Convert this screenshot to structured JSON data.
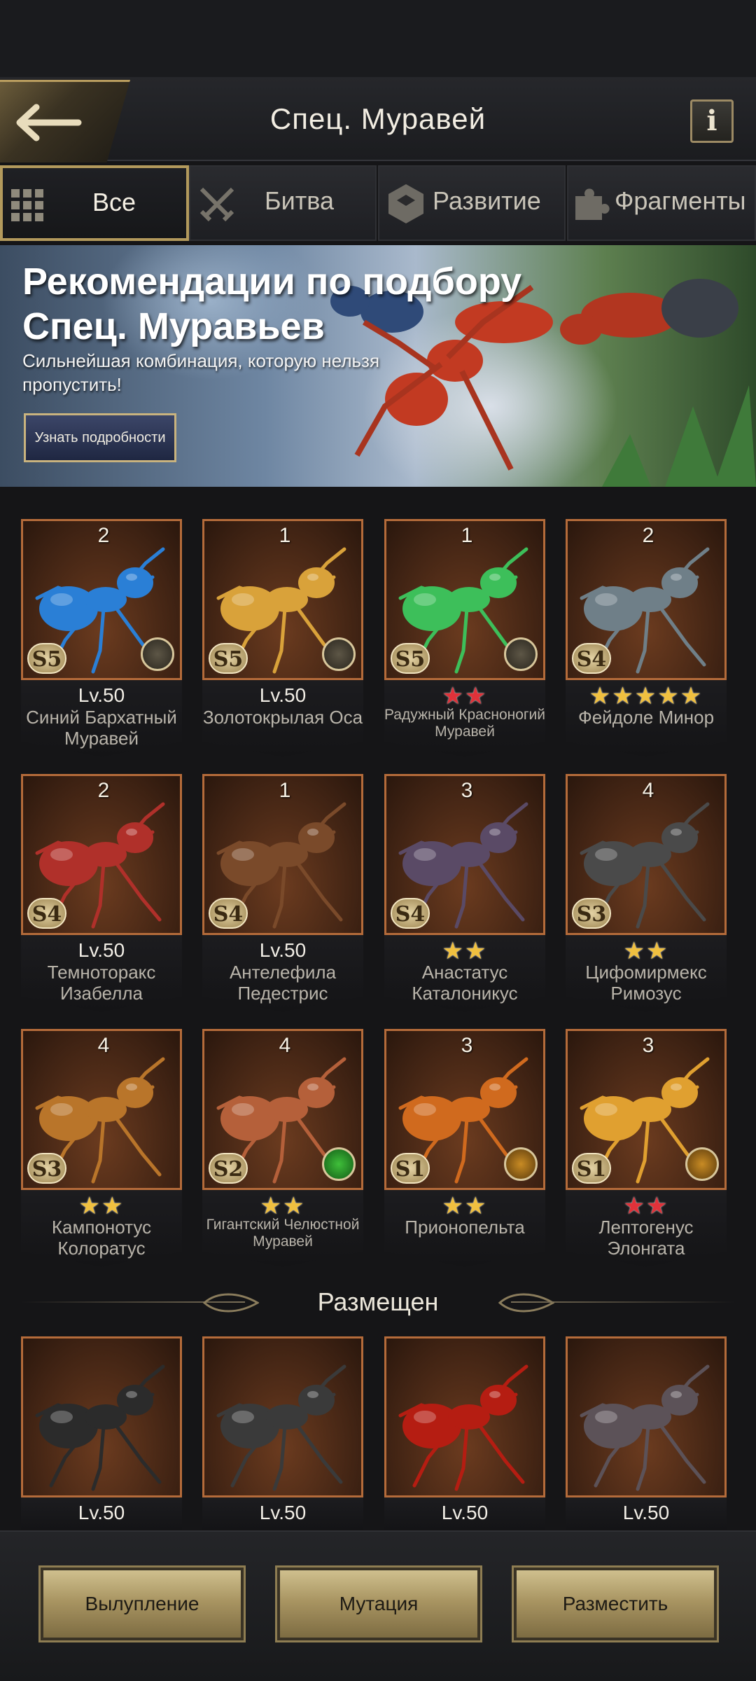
{
  "header": {
    "title": "Спец. Муравей",
    "info_label": "i"
  },
  "tabs": [
    {
      "label": "Все",
      "icon": "grid-icon",
      "active": true
    },
    {
      "label": "Битва",
      "icon": "crossed-swords-icon",
      "active": false
    },
    {
      "label": "Развитие",
      "icon": "hexagon-icon",
      "active": false
    },
    {
      "label": "Фрагменты",
      "icon": "puzzle-icon",
      "active": false
    }
  ],
  "banner": {
    "title": "Рекомендации по подбору Спец. Муравьев",
    "subtitle": "Сильнейшая комбинация, которую нельзя пропустить!",
    "button_label": "Узнать подробности"
  },
  "ants": [
    {
      "count": "2",
      "grade": "S5",
      "badge": "medal-icon",
      "level": "Lv.50",
      "stars": 0,
      "name": "Синий Бархатный Муравей",
      "color": "#2a7fd6"
    },
    {
      "count": "1",
      "grade": "S5",
      "badge": "medal-icon",
      "level": "Lv.50",
      "stars": 0,
      "name": "Золотокрылая Оса",
      "color": "#d9a23a"
    },
    {
      "count": "1",
      "grade": "S5",
      "badge": "medal-icon",
      "level": "",
      "stars": 2,
      "star_color": "red",
      "name": "Радужный Красноногий Муравей",
      "color": "#3dbf5a"
    },
    {
      "count": "2",
      "grade": "S4",
      "badge": "",
      "level": "",
      "stars": 5,
      "star_color": "gold",
      "name": "Фейдоле Минор",
      "color": "#6f7f88"
    },
    {
      "count": "2",
      "grade": "S4",
      "badge": "",
      "level": "Lv.50",
      "stars": 0,
      "name": "Темноторакс Изабелла",
      "color": "#b0302a"
    },
    {
      "count": "1",
      "grade": "S4",
      "badge": "",
      "level": "Lv.50",
      "stars": 0,
      "name": "Антелефила Педестрис",
      "color": "#7a4a2a"
    },
    {
      "count": "3",
      "grade": "S4",
      "badge": "",
      "level": "",
      "stars": 2,
      "star_color": "gold",
      "name": "Анастатус Каталоникус",
      "color": "#5a4a66"
    },
    {
      "count": "4",
      "grade": "S3",
      "badge": "",
      "level": "",
      "stars": 2,
      "star_color": "gold",
      "name": "Цифомирмекс Римозус",
      "color": "#4a4a4a"
    },
    {
      "count": "4",
      "grade": "S3",
      "badge": "",
      "level": "",
      "stars": 2,
      "star_color": "gold",
      "name": "Кампонотус Колоратус",
      "color": "#b9752a"
    },
    {
      "count": "4",
      "grade": "S2",
      "badge": "green",
      "level": "",
      "stars": 2,
      "star_color": "gold",
      "name": "Гигантский Челюстной Муравей",
      "color": "#b5603a"
    },
    {
      "count": "3",
      "grade": "S1",
      "badge": "amber",
      "level": "",
      "stars": 2,
      "star_color": "gold",
      "name": "Прионопельта",
      "color": "#d06a1e"
    },
    {
      "count": "3",
      "grade": "S1",
      "badge": "amber",
      "level": "",
      "stars": 2,
      "star_color": "red",
      "name": "Лептогенус Элонгата",
      "color": "#e0a030"
    }
  ],
  "placed_section": {
    "title": "Размещен",
    "ants": [
      {
        "level": "Lv.50",
        "color": "#2b2b2b"
      },
      {
        "level": "Lv.50",
        "color": "#3a3a3a"
      },
      {
        "level": "Lv.50",
        "color": "#b51d12"
      },
      {
        "level": "Lv.50",
        "color": "#5c5258"
      }
    ]
  },
  "actions": [
    {
      "label": "Вылупление"
    },
    {
      "label": "Мутация"
    },
    {
      "label": "Разместить"
    }
  ]
}
